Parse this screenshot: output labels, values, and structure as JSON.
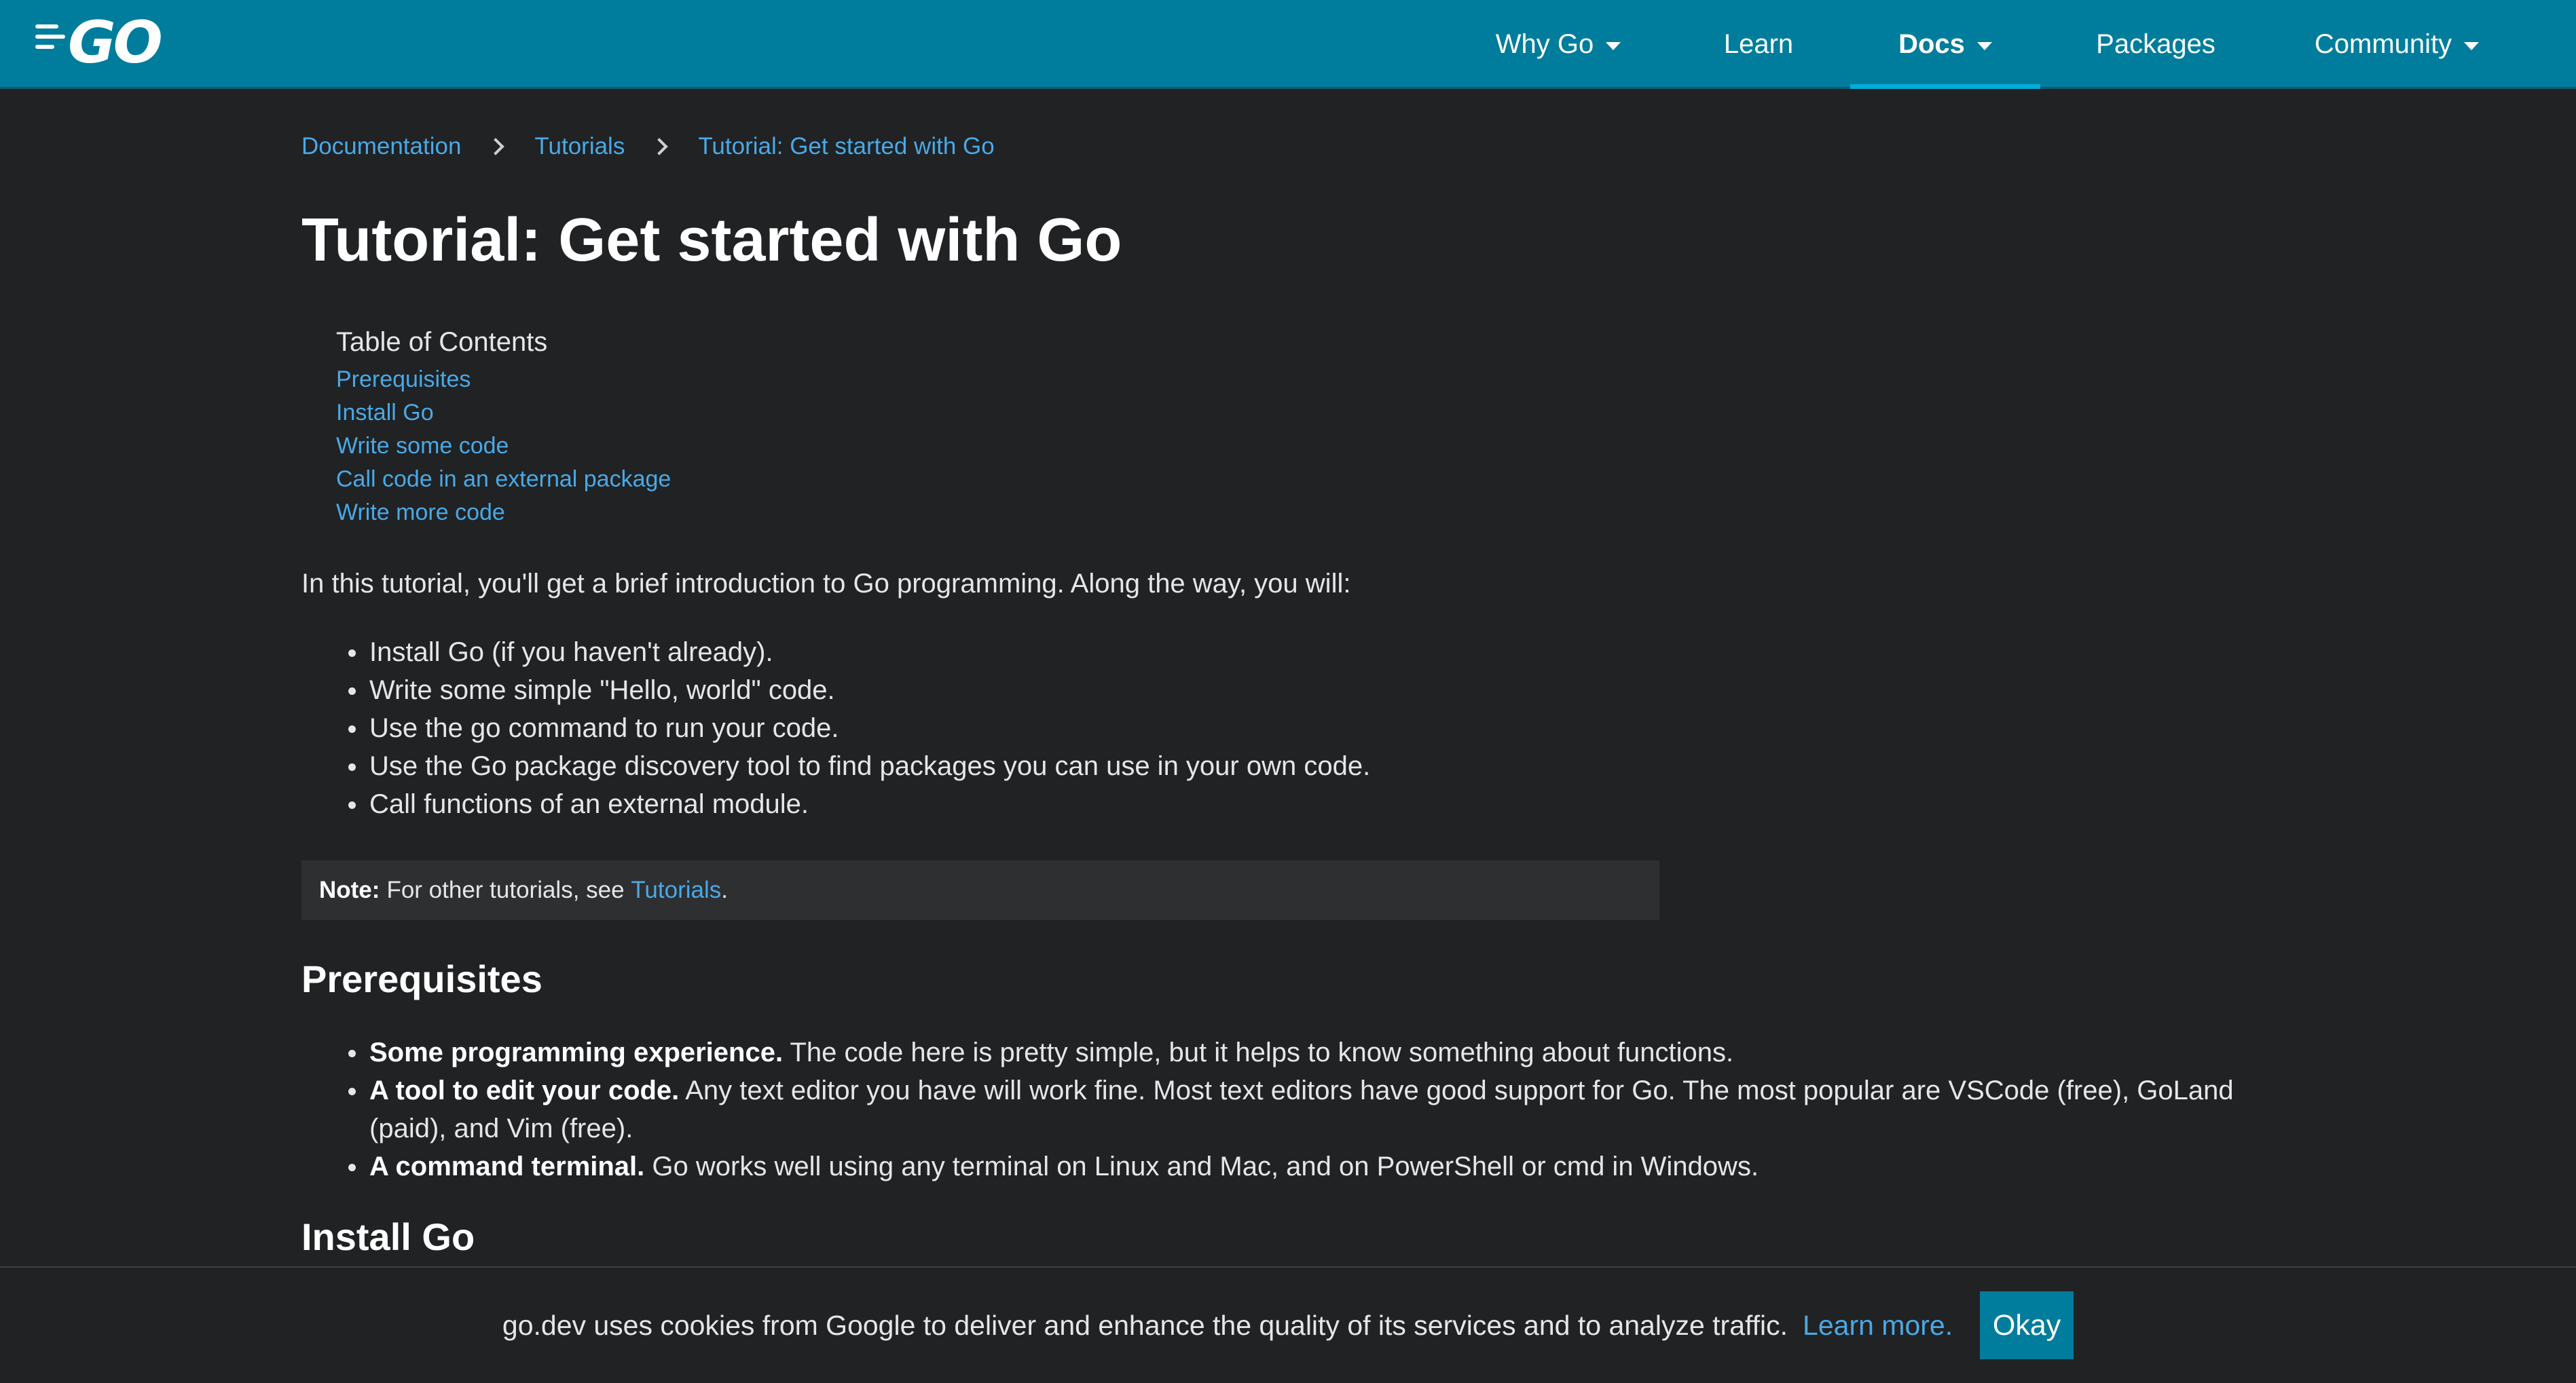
{
  "header": {
    "logo_text": "GO",
    "nav": [
      {
        "label": "Why Go",
        "has_dropdown": true
      },
      {
        "label": "Learn",
        "has_dropdown": false
      },
      {
        "label": "Docs",
        "has_dropdown": true,
        "active": true
      },
      {
        "label": "Packages",
        "has_dropdown": false
      },
      {
        "label": "Community",
        "has_dropdown": true
      }
    ]
  },
  "breadcrumb": [
    "Documentation",
    "Tutorials",
    "Tutorial: Get started with Go"
  ],
  "page_title": "Tutorial: Get started with Go",
  "toc": {
    "heading": "Table of Contents",
    "items": [
      "Prerequisites",
      "Install Go",
      "Write some code",
      "Call code in an external package",
      "Write more code"
    ]
  },
  "intro": "In this tutorial, you'll get a brief introduction to Go programming. Along the way, you will:",
  "intro_bullets": [
    "Install Go (if you haven't already).",
    "Write some simple \"Hello, world\" code.",
    "Use the go command to run your code.",
    "Use the Go package discovery tool to find packages you can use in your own code.",
    "Call functions of an external module."
  ],
  "note": {
    "label": "Note:",
    "text": "For other tutorials, see",
    "link": "Tutorials",
    "suffix": "."
  },
  "prerequisites": {
    "heading": "Prerequisites",
    "items": [
      {
        "bold": "Some programming experience.",
        "text": "The code here is pretty simple, but it helps to know something about functions."
      },
      {
        "bold": "A tool to edit your code.",
        "text": "Any text editor you have will work fine. Most text editors have good support for Go. The most popular are VSCode (free), GoLand (paid), and Vim (free)."
      },
      {
        "bold": "A command terminal.",
        "text": "Go works well using any terminal on Linux and Mac, and on PowerShell or cmd in Windows."
      }
    ]
  },
  "install_heading": "Install Go",
  "cookie": {
    "text": "go.dev uses cookies from Google to deliver and enhance the quality of its services and to analyze traffic.",
    "link": "Learn more.",
    "button": "Okay"
  },
  "colors": {
    "header_bg": "#007d9c",
    "page_bg": "#202224",
    "link": "#4aa9e6",
    "accent_underline": "#00add8"
  }
}
